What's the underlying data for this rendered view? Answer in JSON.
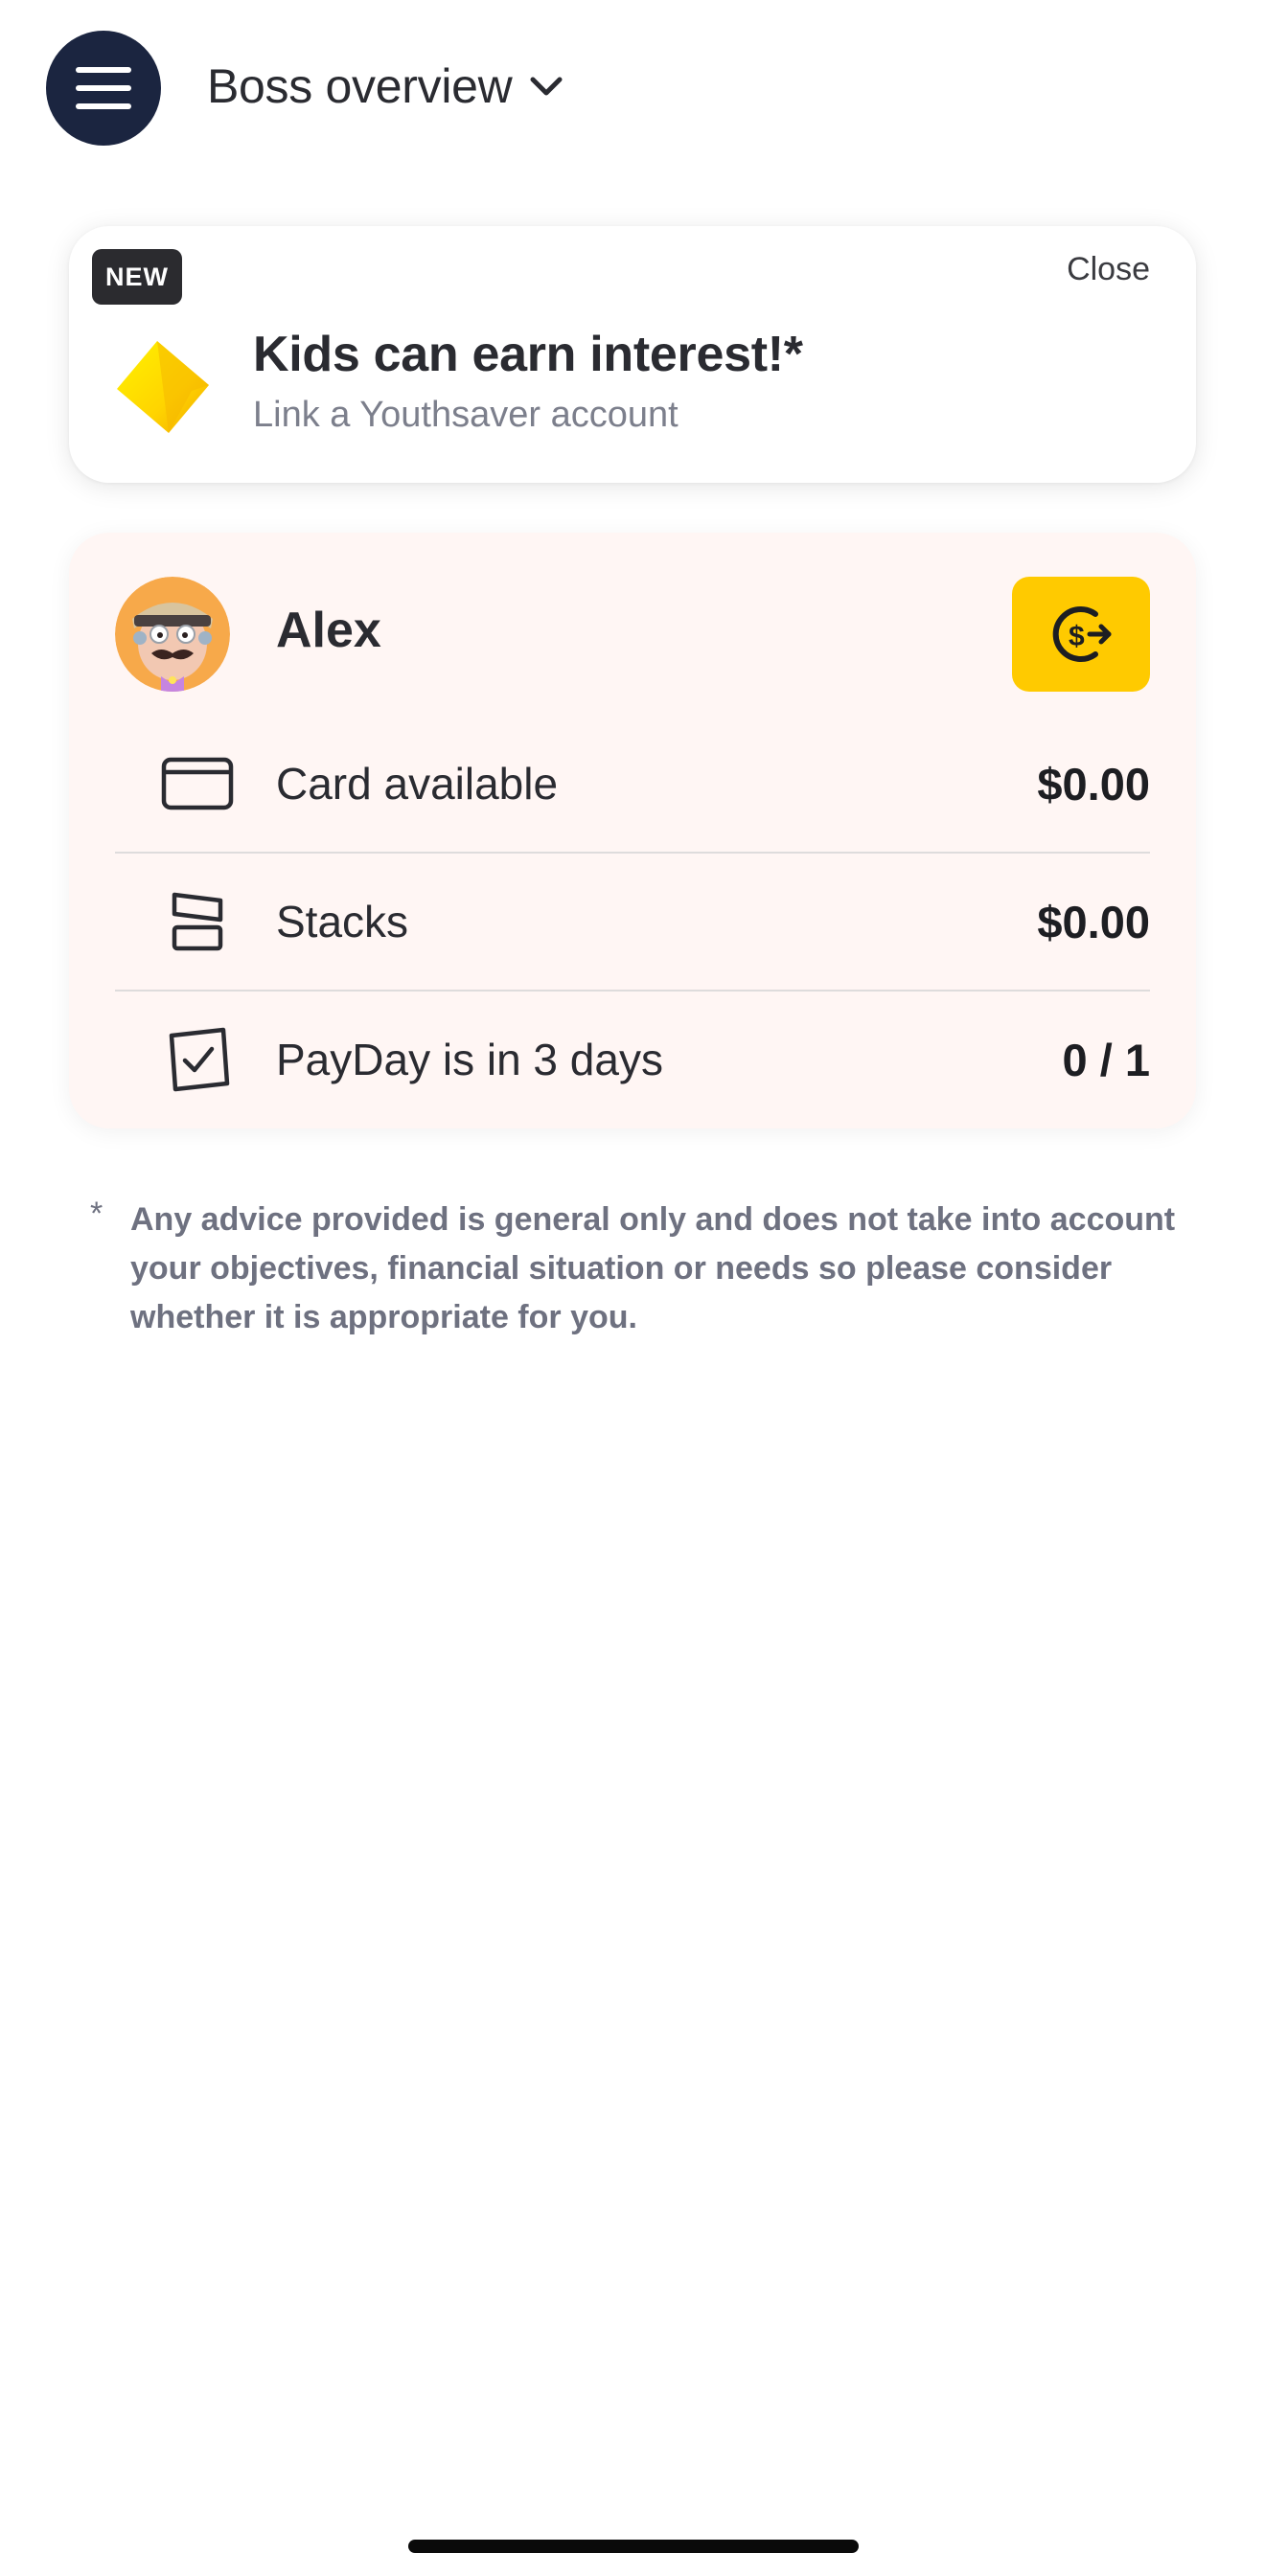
{
  "header": {
    "title": "Boss overview"
  },
  "promo": {
    "badge": "NEW",
    "close_label": "Close",
    "title": "Kids can earn interest!*",
    "subtitle": "Link a Youthsaver account",
    "logo_icon": "commbank-diamond-icon",
    "accent_color": "#ffcc00"
  },
  "child": {
    "name": "Alex",
    "transfer_icon": "dollar-transfer-icon",
    "rows": [
      {
        "icon": "card-icon",
        "label": "Card available",
        "value": "$0.00"
      },
      {
        "icon": "stacks-icon",
        "label": "Stacks",
        "value": "$0.00"
      },
      {
        "icon": "checkbox-icon",
        "label": "PayDay is in 3 days",
        "value": "0 / 1"
      }
    ]
  },
  "disclaimer": {
    "marker": "*",
    "text": "Any advice provided is general only and does not take into account your objectives, financial situation or needs so please consider whether it is appropriate for you."
  },
  "colors": {
    "menu_button": "#1b2540",
    "transfer_button": "#ffca00",
    "child_card_bg": "#fff6f4"
  }
}
